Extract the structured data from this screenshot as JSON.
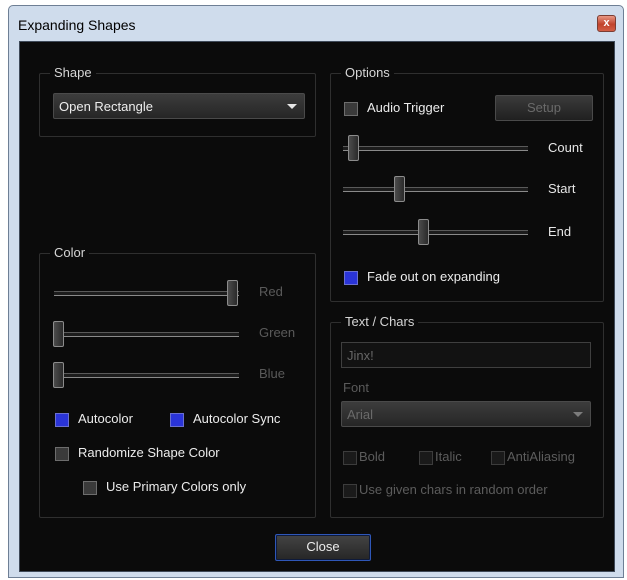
{
  "window": {
    "title": "Expanding Shapes",
    "close_glyph": "x"
  },
  "shape_group": {
    "legend": "Shape",
    "selected": "Open Rectangle"
  },
  "color_group": {
    "legend": "Color",
    "sliders": [
      {
        "label": "Red",
        "value": 1.0
      },
      {
        "label": "Green",
        "value": 0.0
      },
      {
        "label": "Blue",
        "value": 0.0
      }
    ],
    "autocolor": {
      "label": "Autocolor",
      "checked": true
    },
    "autocolor_sync": {
      "label": "Autocolor Sync",
      "checked": true
    },
    "randomize": {
      "label": "Randomize Shape Color",
      "checked": false
    },
    "primary_only": {
      "label": "Use Primary Colors only",
      "checked": false
    }
  },
  "options_group": {
    "legend": "Options",
    "audio_trigger": {
      "label": "Audio Trigger",
      "checked": false
    },
    "setup_label": "Setup",
    "sliders": [
      {
        "label": "Count",
        "value": 0.05
      },
      {
        "label": "Start",
        "value": 0.3
      },
      {
        "label": "End",
        "value": 0.43
      }
    ],
    "fade_out": {
      "label": "Fade out on expanding",
      "checked": true
    }
  },
  "text_group": {
    "legend": "Text / Chars",
    "text_value": "Jinx!",
    "font_label": "Font",
    "font_value": "Arial",
    "bold": {
      "label": "Bold",
      "checked": false
    },
    "italic": {
      "label": "Italic",
      "checked": false
    },
    "antialiasing": {
      "label": "AntiAliasing",
      "checked": false
    },
    "random_order": {
      "label": "Use given chars in random order",
      "checked": false
    }
  },
  "footer": {
    "close_label": "Close"
  },
  "colors": {
    "checkbox_on": "#2a34d8",
    "dialog_bg": "#0b0b0b",
    "frame": "#cfdcec",
    "close_accent": "#2f57b8"
  }
}
